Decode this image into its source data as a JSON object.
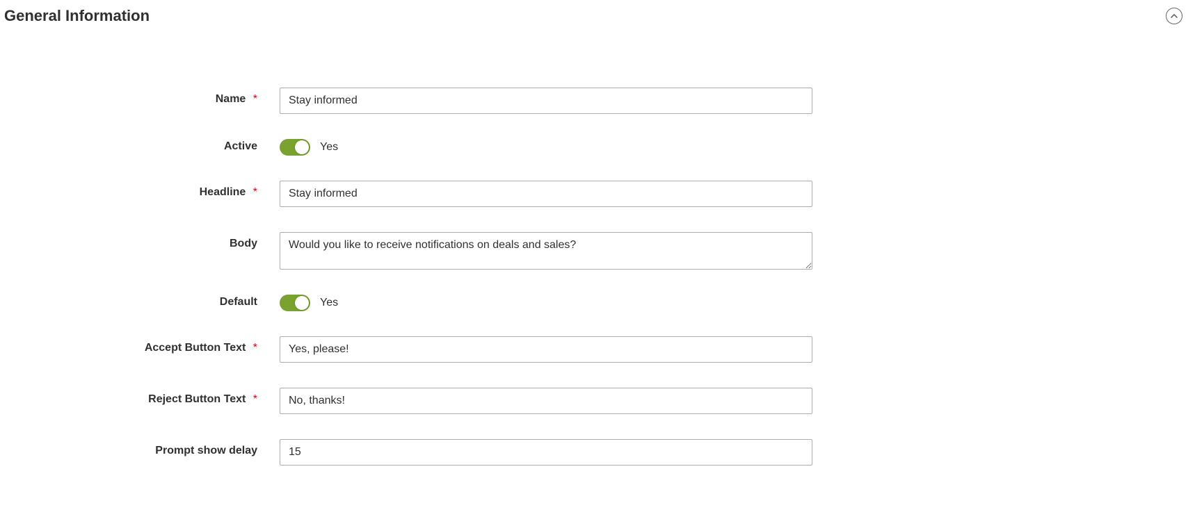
{
  "section": {
    "title": "General Information"
  },
  "labels": {
    "name": "Name",
    "active": "Active",
    "headline": "Headline",
    "body": "Body",
    "default": "Default",
    "accept_button_text": "Accept Button Text",
    "reject_button_text": "Reject Button Text",
    "prompt_show_delay": "Prompt show delay",
    "required_asterisk": "*"
  },
  "values": {
    "name": "Stay informed",
    "active_text": "Yes",
    "headline": "Stay informed",
    "body": "Would you like to receive notifications on deals and sales?",
    "default_text": "Yes",
    "accept_button_text": "Yes, please!",
    "reject_button_text": "No, thanks!",
    "prompt_show_delay": "15"
  },
  "colors": {
    "toggle_on": "#79a22e",
    "required": "#d0021b"
  }
}
